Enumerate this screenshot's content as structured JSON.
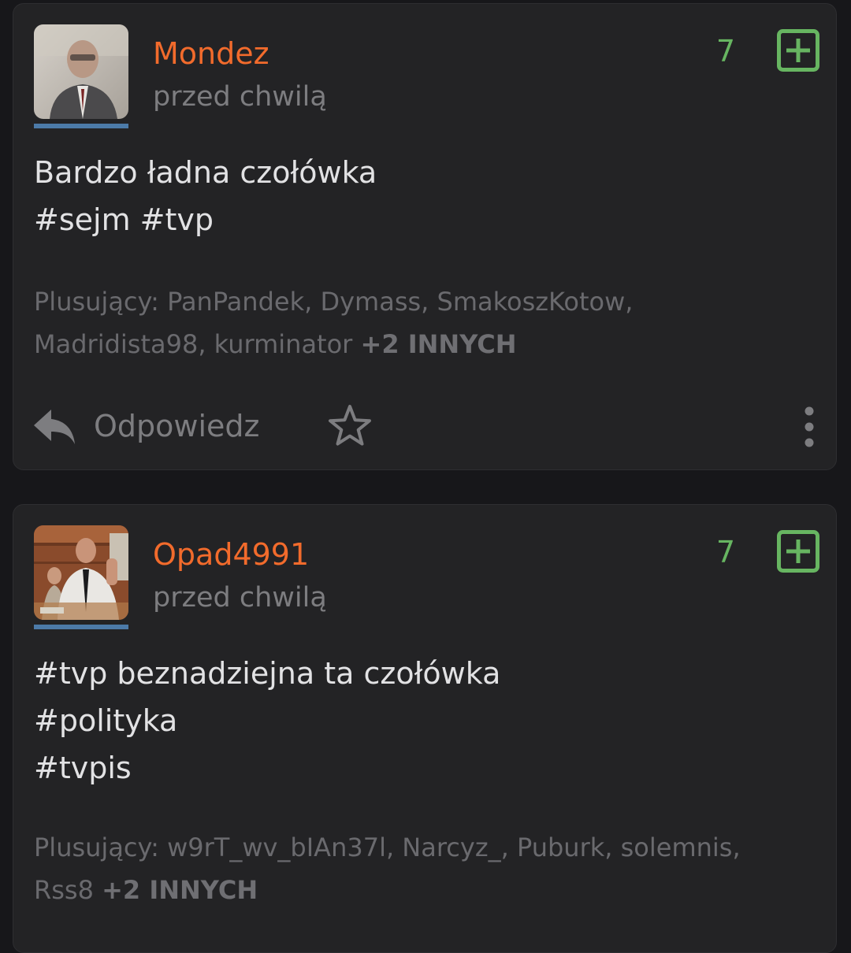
{
  "posts": [
    {
      "username": "Mondez",
      "time": "przed chwilą",
      "score": "7",
      "content": [
        "Bardzo ładna czołówka",
        "#sejm #tvp"
      ],
      "voters_label": "Plusujący:",
      "voters_line1": "PanPandek, Dymass, SmakoszKotow,",
      "voters_line2": "Madridista98, kurminator",
      "voters_more": "+2 INNYCH",
      "reply_label": "Odpowiedz"
    },
    {
      "username": "Opad4991",
      "time": "przed chwilą",
      "score": "7",
      "content": [
        "#tvp beznadziejna ta czołówka",
        "#polityka",
        "#tvpis"
      ],
      "voters_label": "Plusujący:",
      "voters_line1": "w9rT_wv_bIAn37l, Narcyz_, Puburk, solemnis,",
      "voters_line2": "Rss8",
      "voters_more": "+2 INNYCH"
    }
  ],
  "colors": {
    "background": "#17171a",
    "card": "#232325",
    "username": "#f26b2c",
    "score": "#67b561",
    "avatar_underline": "#4c7aa8",
    "muted_text": "#7d7d80",
    "content_text": "#e2e2e4"
  },
  "icons": {
    "vote": "plus-square-icon",
    "reply": "reply-arrow-icon",
    "favorite": "star-outline-icon",
    "menu": "vertical-dots-icon"
  }
}
